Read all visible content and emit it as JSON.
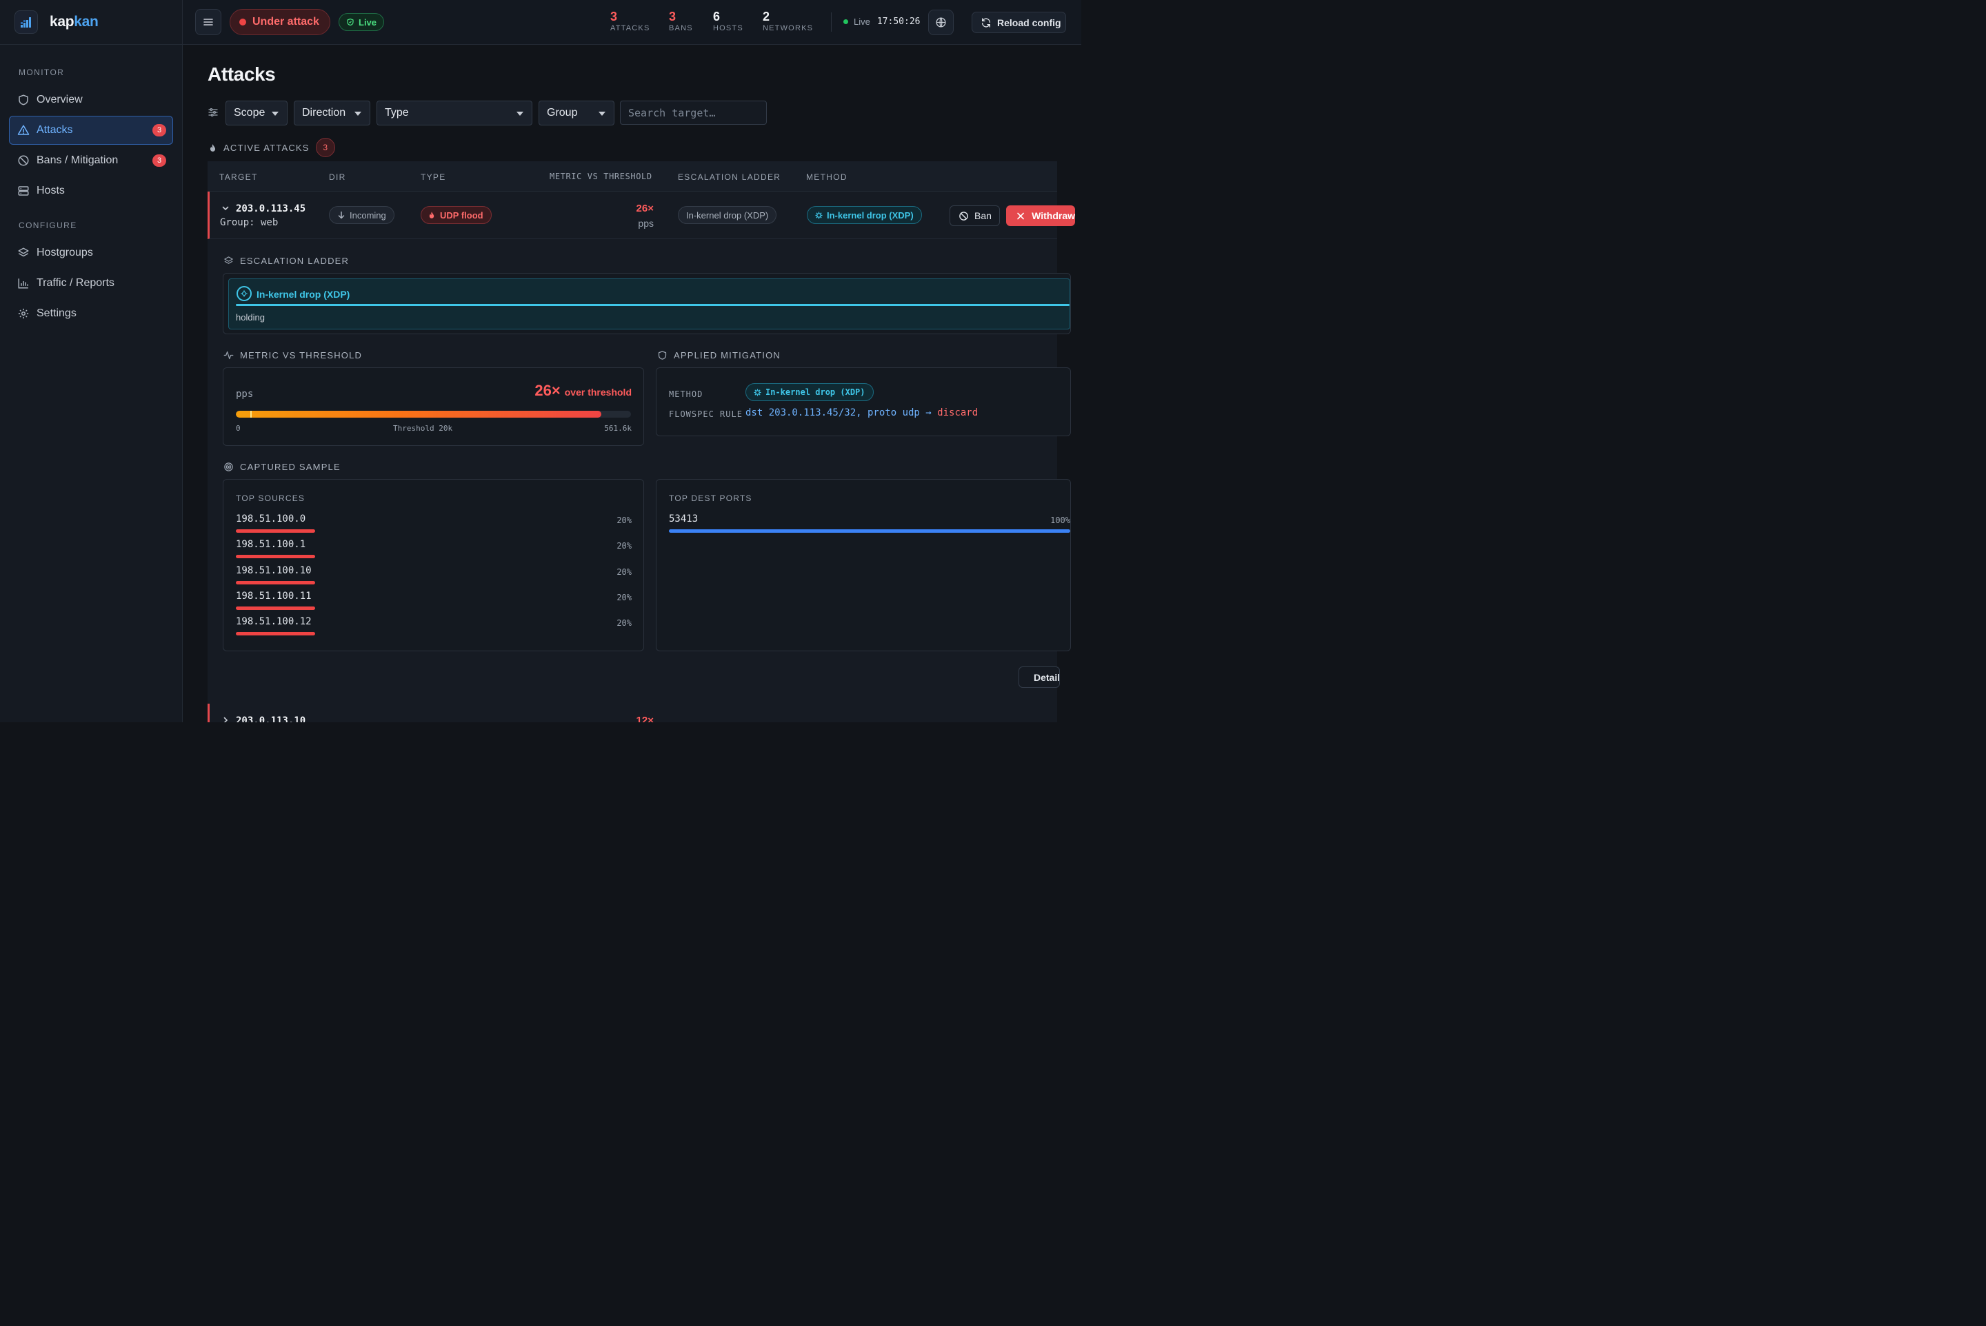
{
  "brand": {
    "name_a": "kap",
    "name_b": "kan"
  },
  "sidebar": {
    "sections": [
      "MONITOR",
      "CONFIGURE"
    ],
    "items": [
      {
        "label": "Overview",
        "icon": "shield-icon"
      },
      {
        "label": "Attacks",
        "icon": "warning-triangle-icon",
        "badge": "3",
        "active": true
      },
      {
        "label": "Bans / Mitigation",
        "icon": "ban-icon",
        "badge": "3"
      },
      {
        "label": "Hosts",
        "icon": "server-icon"
      },
      {
        "label": "Hostgroups",
        "icon": "layers-icon"
      },
      {
        "label": "Traffic / Reports",
        "icon": "bar-chart-icon"
      },
      {
        "label": "Settings",
        "icon": "gear-icon"
      }
    ]
  },
  "topbar": {
    "status": "Under attack",
    "live_badge": "Live",
    "stats": [
      {
        "value": "3",
        "label": "ATTACKS"
      },
      {
        "value": "3",
        "label": "BANS"
      },
      {
        "value": "6",
        "label": "HOSTS"
      },
      {
        "value": "2",
        "label": "NETWORKS"
      }
    ],
    "live_label": "Live",
    "time": "17:50:26",
    "reload_label": "Reload config"
  },
  "page": {
    "title": "Attacks"
  },
  "filters": {
    "scope": "Scope",
    "direction": "Direction",
    "type": "Type",
    "group": "Group",
    "search_placeholder": "Search target…"
  },
  "active": {
    "label": "ACTIVE ATTACKS",
    "count": "3"
  },
  "table": {
    "columns": [
      "TARGET",
      "DIR",
      "TYPE",
      "METRIC VS THRESHOLD",
      "ESCALATION LADDER",
      "METHOD"
    ],
    "rows": [
      {
        "target": "203.0.113.45",
        "group": "Group: web",
        "dir": "Incoming",
        "type": "UDP flood",
        "multiplier": "26×",
        "unit": "pps",
        "escalation": "In-kernel drop (XDP)",
        "method": "In-kernel drop (XDP)",
        "ban_label": "Ban",
        "withdraw_label": "Withdraw"
      },
      {
        "target": "203.0.113.10",
        "multiplier": "12×"
      }
    ]
  },
  "detail": {
    "ladder_label": "ESCALATION LADDER",
    "ladder_step": "In-kernel drop (XDP)",
    "ladder_state": "holding",
    "metric_label": "METRIC VS THRESHOLD",
    "metric_unit": "pps",
    "metric_multiplier": "26×",
    "metric_over": "over threshold",
    "metric_fill": 0.925,
    "metric_threshold_pos": 0.036,
    "scale_min": "0",
    "scale_threshold": "Threshold 20k",
    "scale_max": "561.6k",
    "mitigation_label": "APPLIED MITIGATION",
    "method_key": "METHOD",
    "method_value": "In-kernel drop (XDP)",
    "flowspec_key": "FLOWSPEC RULE",
    "flowspec_rule": "dst 203.0.113.45/32, proto udp →",
    "flowspec_action": "discard",
    "sample_label": "CAPTURED SAMPLE",
    "sources_label": "TOP SOURCES",
    "sources": [
      {
        "ip": "198.51.100.0",
        "pct": "20%",
        "share": 0.2
      },
      {
        "ip": "198.51.100.1",
        "pct": "20%",
        "share": 0.2
      },
      {
        "ip": "198.51.100.10",
        "pct": "20%",
        "share": 0.2
      },
      {
        "ip": "198.51.100.11",
        "pct": "20%",
        "share": 0.2
      },
      {
        "ip": "198.51.100.12",
        "pct": "20%",
        "share": 0.2
      }
    ],
    "ports_label": "TOP DEST PORTS",
    "ports": [
      {
        "port": "53413",
        "pct": "100%",
        "share": 1.0
      }
    ],
    "details_label": "Details"
  },
  "colors": {
    "accent": "#4da3f0",
    "danger": "#e5484d",
    "cyan": "#3fc6e8",
    "ok": "#22c55e"
  }
}
